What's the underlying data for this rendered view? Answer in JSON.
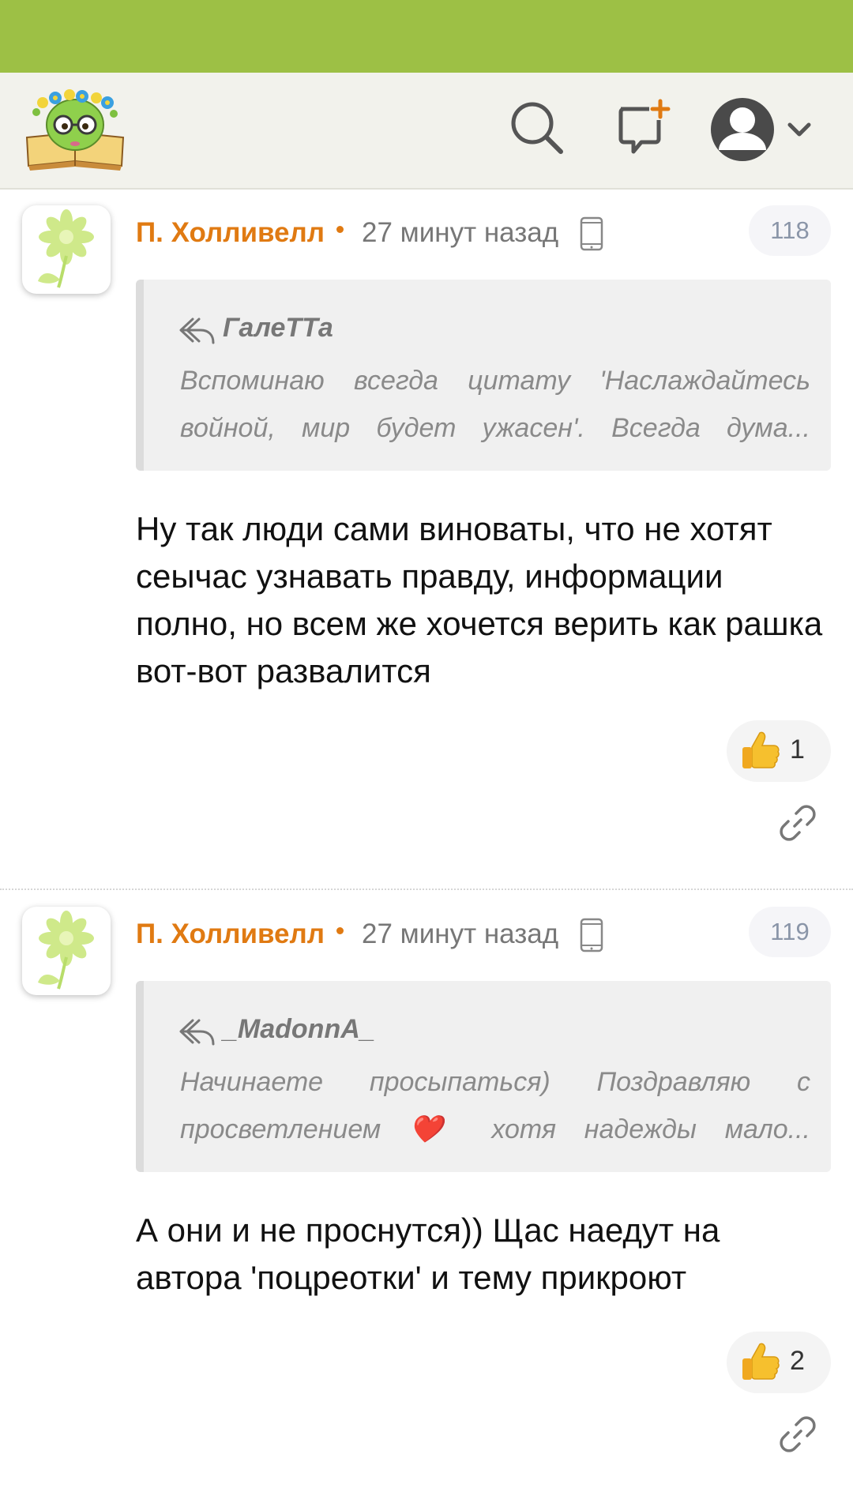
{
  "header": {
    "search_label": "search",
    "new_post_label": "new post",
    "profile_label": "profile"
  },
  "comments": [
    {
      "author": "П. Холливелл",
      "time": "27 минут назад",
      "number": "118",
      "quote_author": "ГалеТТа",
      "quote_lines": [
        "Вспоминаю всегда цитату 'Наслаждайтесь",
        "войной, мир будет ужасен'. Всегда дума..."
      ],
      "text": "Ну так люди сами виноваты, что не хотят сеычас узнавать правду, информации полно, но всем же хочется верить как рашка вот-вот развалится",
      "likes": "1"
    },
    {
      "author": "П. Холливелл",
      "time": "27 минут назад",
      "number": "119",
      "quote_author": "_MadonnA_",
      "quote_lines": [
        "Начинаете просыпаться) Поздравляю с",
        "просветлением ❤️ хотя надежды мало..."
      ],
      "text": "А они и не проснутся)) Щас наедут на автора 'поцреотки' и тему прикроют",
      "likes": "2"
    }
  ],
  "colors": {
    "statusbar": "#9dc045",
    "accent": "#e07a12",
    "header_bg": "#f2f2ec"
  }
}
